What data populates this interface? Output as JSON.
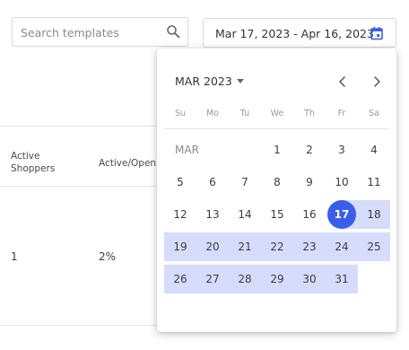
{
  "search": {
    "placeholder": "Search templates",
    "icon": "search-icon"
  },
  "date_range": {
    "value": "Mar 17, 2023 - Apr 16, 2023",
    "icon": "calendar-icon",
    "accent": "#3b5ee8"
  },
  "table": {
    "columns": [
      "Active\nShoppers",
      "Active/Open"
    ],
    "rows": [
      [
        "1",
        "2%"
      ]
    ]
  },
  "calendar": {
    "month_select": "MAR 2023",
    "month_label": "MAR",
    "weekdays": [
      "Su",
      "Mo",
      "Tu",
      "We",
      "Th",
      "Fr",
      "Sa"
    ],
    "selected_color": "#3b5ee8",
    "range_color": "#d6dcfb",
    "selected_day": "17",
    "weeks": [
      [
        "",
        "",
        "",
        "1",
        "2",
        "3",
        "4"
      ],
      [
        "5",
        "6",
        "7",
        "8",
        "9",
        "10",
        "11"
      ],
      [
        "12",
        "13",
        "14",
        "15",
        "16",
        "17",
        "18"
      ],
      [
        "19",
        "20",
        "21",
        "22",
        "23",
        "24",
        "25"
      ],
      [
        "26",
        "27",
        "28",
        "29",
        "30",
        "31",
        ""
      ]
    ]
  }
}
